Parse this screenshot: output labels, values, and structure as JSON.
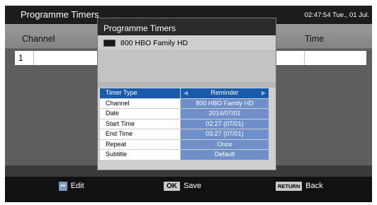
{
  "header": {
    "title": "Programme Timers",
    "clock": "02:47:54 Tue., 01 Jul."
  },
  "columns": {
    "channel": "Channel",
    "time": "Time"
  },
  "list": {
    "row1_number": "1"
  },
  "dialog": {
    "title": "Programme Timers",
    "channel_line": "800  HBO Family HD",
    "settings": [
      {
        "label": "Timer Type",
        "value": "Reminder"
      },
      {
        "label": "Channel",
        "value": "800 HBO Family HD"
      },
      {
        "label": "Date",
        "value": "2014/07/01"
      },
      {
        "label": "Start Time",
        "value": "02:27 (07/01)"
      },
      {
        "label": "End Time",
        "value": "03:27 (07/01)"
      },
      {
        "label": "Repeat",
        "value": "Once"
      },
      {
        "label": "Subtitle",
        "value": "Default"
      }
    ]
  },
  "footer": {
    "edit": {
      "key": "◂ ▸",
      "label": "Edit"
    },
    "save": {
      "key": "OK",
      "label": "Save"
    },
    "back": {
      "key": "RETURN",
      "label": "Back"
    }
  },
  "icons": {
    "channel": "tv-icon",
    "left_arrow": "arrow-left-icon",
    "right_arrow": "arrow-right-icon"
  },
  "colors": {
    "highlight": "#1a5aaa",
    "value_bg": "#6e8fc9"
  }
}
